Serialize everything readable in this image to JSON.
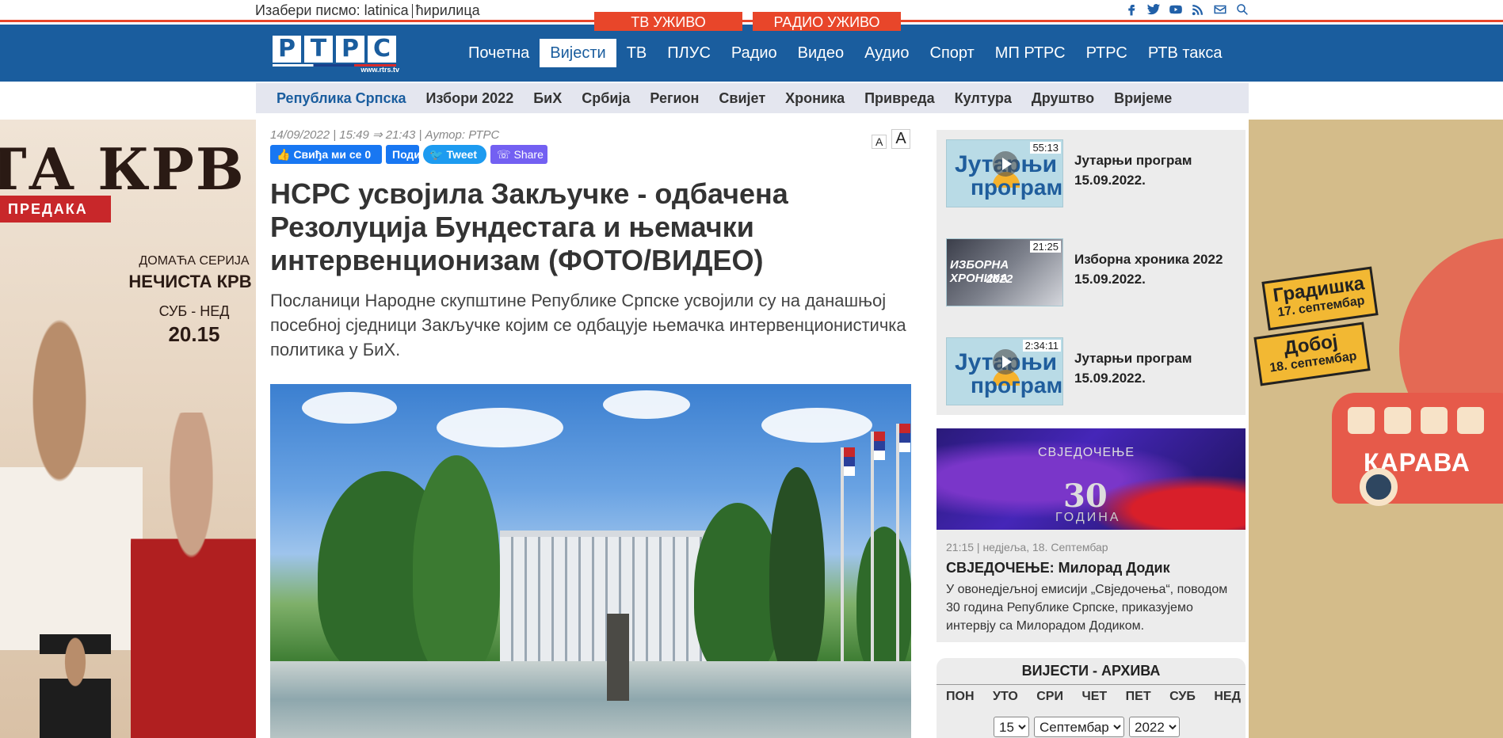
{
  "topbar": {
    "script_label": "Изабери писмо:",
    "latin": "latinica",
    "cyrillic": "ћирилица",
    "live_tv": "ТВ УЖИВО",
    "live_radio": "РАДИО УЖИВО"
  },
  "social_icons": [
    "facebook-icon",
    "twitter-icon",
    "youtube-icon",
    "rss-icon",
    "mail-icon",
    "search-icon"
  ],
  "logo": {
    "letters": [
      "Р",
      "Т",
      "Р",
      "С"
    ],
    "url": "www.rtrs.tv"
  },
  "mainnav": [
    "Почетна",
    "Вијести",
    "ТВ",
    "ПЛУС",
    "Радио",
    "Видео",
    "Аудио",
    "Спорт",
    "МП РТРС",
    "РТРС",
    "РТВ такса"
  ],
  "mainnav_active": "Вијести",
  "subnav": [
    "Република Српска",
    "Избори 2022",
    "БиХ",
    "Србија",
    "Регион",
    "Свијет",
    "Хроника",
    "Привреда",
    "Култура",
    "Друштво",
    "Вријеме"
  ],
  "subnav_active": "Република Српска",
  "article": {
    "meta": "14/09/2022 |  15:49 ⇒ 21:43 | Аутор: РТРС",
    "font_small": "A",
    "font_big": "A",
    "like_label": "Свиђа ми се",
    "like_count": "0",
    "share_fb": "Подијели",
    "tweet": "Tweet",
    "viber": "Share",
    "headline": "НСРС усвојила Закључке - одбачена Резолуција Бундестага и њемачки интервенционизам (ФОТО/ВИДЕО)",
    "lead": "Посланици Народне скупштине Републике Српске усвојили су на данашњој посебној сједници Закључке којим се одбацује њемачка интервенционистичка политика у БиХ."
  },
  "ad_left": {
    "title": "ТА КРВ",
    "ribbon": "ПРЕДАКА",
    "small": "ДОМАЋА СЕРИЈА",
    "big": "НЕЧИСТА КРВ",
    "days": "СУБ - НЕД",
    "time": "20.15"
  },
  "ad_right": {
    "tag1_city": "Градишка",
    "tag1_date": "17. септембар",
    "tag2_city": "Добој",
    "tag2_date": "18. септембар",
    "bus_text": "КАРАВА"
  },
  "sidebar": {
    "videos": [
      {
        "duration": "55:13",
        "thumb_top": "Јутарњи",
        "thumb_bottom": "програм",
        "title": "Јутарњи програм 15.09.2022."
      },
      {
        "duration": "21:25",
        "thumb_top": "ИЗБОРНА ХРОНИКА",
        "thumb_bottom": "2022",
        "title": "Изборна хроника 2022 15.09.2022."
      },
      {
        "duration": "2:34:11",
        "thumb_top": "Јутарњи",
        "thumb_bottom": "програм",
        "title": "Јутарњи програм 15.09.2022."
      }
    ],
    "promo": {
      "img_title": "СВЈЕДОЧЕЊЕ",
      "img_number": "30",
      "img_sub": "ГОДИНА",
      "meta": "21:15 | недјеља, 18. Септембар",
      "title": "СВЈЕДОЧЕЊЕ: Милорад Додик",
      "text": "У овонедјељној емисији „Свједочења“, поводом 30 година Републике Српске, приказујемо интервју са Милорадом Додиком."
    },
    "archive": {
      "title": "ВИЈЕСТИ - АРХИВА",
      "days": [
        "ПОН",
        "УТО",
        "СРИ",
        "ЧЕТ",
        "ПЕТ",
        "СУБ",
        "НЕД"
      ],
      "day": "15",
      "month": "Септембар",
      "year": "2022"
    }
  },
  "colors": {
    "brand_blue": "#1a5d9e",
    "live_red": "#e8462a"
  }
}
